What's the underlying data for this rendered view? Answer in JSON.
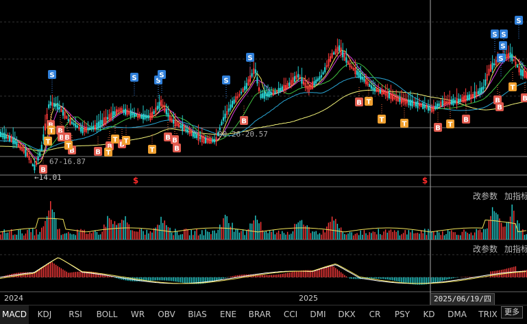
{
  "price_labels": {
    "low_marker": "←14.01",
    "range_left": "67-16.87",
    "range_mid": "00.26-20.57"
  },
  "panels": {
    "volume": {
      "modify_params": "改参数",
      "add_indicator": "加指标"
    },
    "macd": {
      "modify_params": "改参数",
      "add_indicator": "加指标"
    }
  },
  "x_axis": {
    "year_left": "2024",
    "year_mid": "2025",
    "cursor_date": "2025/06/19/四"
  },
  "tabs": [
    "MACD",
    "KDJ",
    "RSI",
    "BOLL",
    "WR",
    "OBV",
    "BIAS",
    "ENE",
    "BRAR",
    "CCI",
    "DMI",
    "DKX",
    "CR",
    "PSY",
    "KD",
    "DMA",
    "TRIX"
  ],
  "active_tab": "MACD",
  "more_button": "更多",
  "signal_letters": {
    "sell": "S",
    "buy": "B",
    "t": "T",
    "dollar": "$"
  },
  "colors": {
    "up": "#ff3b3b",
    "down": "#26d0d0",
    "ma5": "#ffffff",
    "ma10": "#f2e35a",
    "ma20": "#e040e0",
    "ma60": "#40c040",
    "ma120": "#2aa7d6",
    "ma250": "#f5f57a",
    "sell_badge": "#2f7fd9",
    "buy_badge": "#e05a4e",
    "t_badge": "#f0a030"
  }
}
